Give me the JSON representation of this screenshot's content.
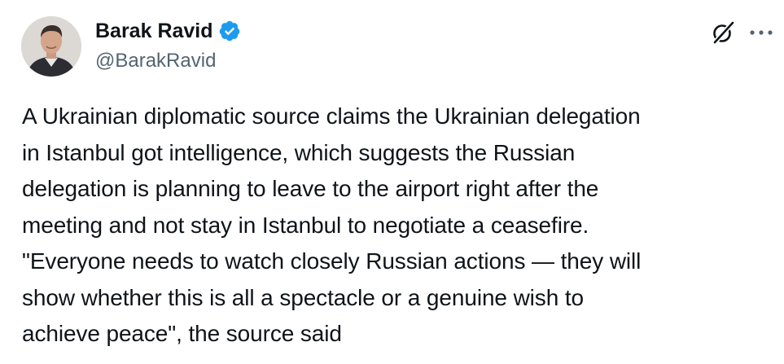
{
  "author": {
    "display_name": "Barak Ravid",
    "handle": "@BarakRavid",
    "verified": true,
    "verified_color": "#1d9bf0"
  },
  "icons": {
    "verified": "verified-badge-icon",
    "grok": "grok-icon",
    "more": "more-options-icon"
  },
  "tweet": {
    "text": "A Ukrainian diplomatic source claims the Ukrainian delegation\nin Istanbul got intelligence, which suggests the Russian\ndelegation is planning to leave to the airport right after the\nmeeting and not stay in Istanbul to negotiate a ceasefire.\n\"Everyone needs to watch closely Russian actions — they will\nshow whether this is all a spectacle or a genuine wish to\nachieve peace\", the source said"
  },
  "colors": {
    "text_primary": "#0f1419",
    "text_secondary": "#536471",
    "background": "#ffffff"
  }
}
